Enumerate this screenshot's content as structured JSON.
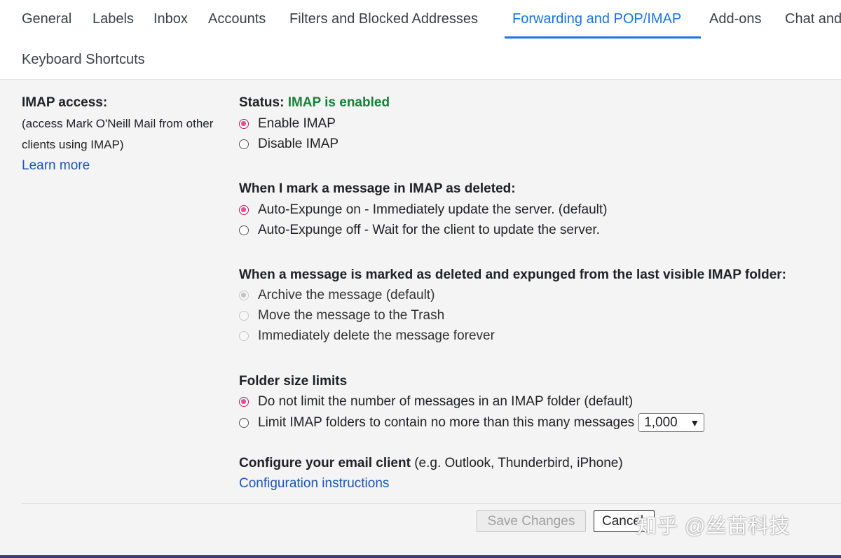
{
  "tabs": [
    {
      "label": "General"
    },
    {
      "label": "Labels"
    },
    {
      "label": "Inbox"
    },
    {
      "label": "Accounts"
    },
    {
      "label": "Filters and Blocked Addresses"
    },
    {
      "label": "Forwarding and POP/IMAP",
      "active": true
    },
    {
      "label": "Add-ons"
    },
    {
      "label": "Chat and"
    },
    {
      "label": "Keyboard Shortcuts"
    }
  ],
  "imap_access": {
    "title": "IMAP access:",
    "description": "(access Mark O'Neill Mail from other clients using IMAP)",
    "learn_more": "Learn more"
  },
  "status": {
    "label": "Status:",
    "value": "IMAP is enabled",
    "options": [
      "Enable IMAP",
      "Disable IMAP"
    ],
    "selected": "Enable IMAP"
  },
  "deleted": {
    "heading": "When I mark a message in IMAP as deleted:",
    "options": [
      "Auto-Expunge on - Immediately update the server. (default)",
      "Auto-Expunge off - Wait for the client to update the server."
    ],
    "selected": "Auto-Expunge on - Immediately update the server. (default)"
  },
  "expunged": {
    "heading": "When a message is marked as deleted and expunged from the last visible IMAP folder:",
    "options": [
      "Archive the message (default)",
      "Move the message to the Trash",
      "Immediately delete the message forever"
    ],
    "selected": "Archive the message (default)",
    "disabled": true
  },
  "folder_size": {
    "heading": "Folder size limits",
    "options": [
      "Do not limit the number of messages in an IMAP folder (default)",
      "Limit IMAP folders to contain no more than this many messages"
    ],
    "selected": "Do not limit the number of messages in an IMAP folder (default)",
    "limit_value": "1,000"
  },
  "configure": {
    "heading": "Configure your email client",
    "note": "(e.g. Outlook, Thunderbird, iPhone)",
    "link": "Configuration instructions"
  },
  "buttons": {
    "save": "Save Changes",
    "cancel": "Cancel"
  },
  "watermark": "知乎 @丝苗科技",
  "colors": {
    "accent": "#1a73e8",
    "status_enabled": "#188038",
    "radio_checked": "#e25591"
  }
}
